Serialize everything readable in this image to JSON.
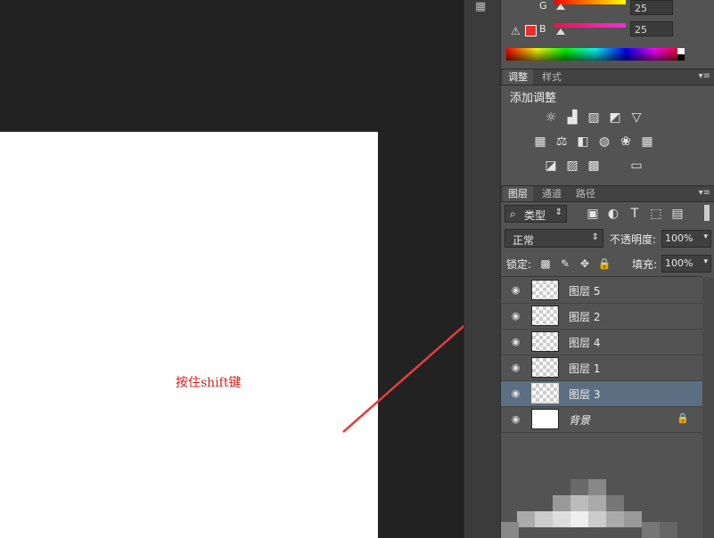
{
  "canvas": {
    "annotation": "按住shift键"
  },
  "color_panel": {
    "g_label": "G",
    "b_label": "B",
    "g_value": "25",
    "b_value": "25",
    "warning_icon": "warning-triangle-icon",
    "gamut_swatch_color": "#e53030"
  },
  "adjustments_panel": {
    "tabs": [
      "调整",
      "样式"
    ],
    "title": "添加调整",
    "row1": [
      "brightness-icon",
      "levels-icon",
      "curves-icon",
      "exposure-icon",
      "vibrance-icon"
    ],
    "row2": [
      "hue-saturation-icon",
      "color-balance-icon",
      "black-white-icon",
      "photo-filter-icon",
      "channel-mixer-icon",
      "color-lookup-icon"
    ],
    "row3": [
      "invert-icon",
      "posterize-icon",
      "threshold-icon",
      "gradient-map-icon"
    ]
  },
  "layers_panel": {
    "tabs": [
      "图层",
      "通道",
      "路径"
    ],
    "filter_label": "类型",
    "blend_mode": "正常",
    "opacity_label": "不透明度:",
    "opacity_value": "100%",
    "lock_label": "锁定:",
    "fill_label": "填充:",
    "fill_value": "100%",
    "layers": [
      {
        "name": "图层 5",
        "selected": false,
        "highlighted": true
      },
      {
        "name": "图层 2",
        "selected": false
      },
      {
        "name": "图层 4",
        "selected": false
      },
      {
        "name": "图层 1",
        "selected": false
      },
      {
        "name": "图层 3",
        "selected": true
      },
      {
        "name": "背景",
        "selected": false,
        "locked": true,
        "background": true
      }
    ]
  },
  "colors": {
    "annotation_red": "#e53e3e",
    "selected_layer": "#5c6f82",
    "panel_bg": "#535353"
  }
}
